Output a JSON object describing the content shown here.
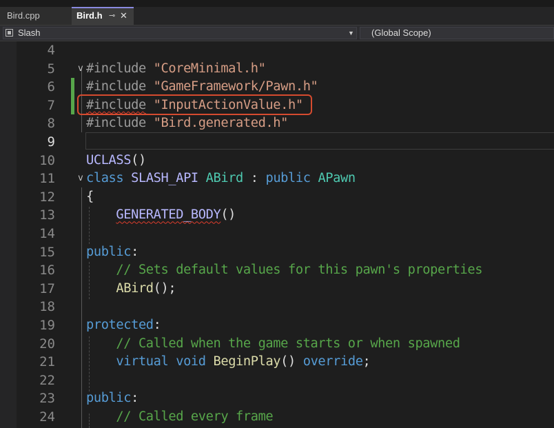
{
  "tabs": [
    {
      "label": "Bird.cpp",
      "active": false
    },
    {
      "label": "Bird.h",
      "active": true,
      "pin_icon": "pin-icon",
      "close_icon": "close-icon"
    }
  ],
  "nav": {
    "project": "Slash",
    "scope": "(Global Scope)"
  },
  "editor": {
    "current_line": 9,
    "lines": [
      {
        "n": "4"
      },
      {
        "n": "5"
      },
      {
        "n": "6"
      },
      {
        "n": "7"
      },
      {
        "n": "8"
      },
      {
        "n": "9"
      },
      {
        "n": "10"
      },
      {
        "n": "11"
      },
      {
        "n": "12"
      },
      {
        "n": "13"
      },
      {
        "n": "14"
      },
      {
        "n": "15"
      },
      {
        "n": "16"
      },
      {
        "n": "17"
      },
      {
        "n": "18"
      },
      {
        "n": "19"
      },
      {
        "n": "20"
      },
      {
        "n": "21"
      },
      {
        "n": "22"
      },
      {
        "n": "23"
      },
      {
        "n": "24"
      }
    ],
    "tokens": {
      "include": "#include",
      "inc1": "\"CoreMinimal.h\"",
      "inc2": "\"GameFramework/Pawn.h\"",
      "inc3": "\"InputActionValue.h\"",
      "inc4": "\"Bird.generated.h\"",
      "uclass": "UCLASS",
      "paren": "()",
      "class_kw": "class",
      "api": "SLASH_API",
      "abird": "ABird",
      "colon": " : ",
      "public_kw": "public",
      "apawn": "APawn",
      "lbrace": "{",
      "generated_body": "GENERATED_BODY",
      "public_label": "public",
      "protected_label": "protected",
      "colon_end": ":",
      "comment1": "// Sets default values for this pawn's properties",
      "ctor": "ABird",
      "ctor_end": "();",
      "comment2": "// Called when the game starts or when spawned",
      "virtual_kw": "virtual",
      "void_kw": "void",
      "beginplay": "BeginPlay",
      "override_kw": "override",
      "semi": ";",
      "comment3": "// Called every frame"
    },
    "fold_glyph": "v",
    "colors": {
      "keyword": "#569cd6",
      "type": "#4ec9b0",
      "string": "#d69d85",
      "comment": "#57a64a",
      "macro": "#bd63c5",
      "function": "#dcdcaa",
      "highlight_box": "#d64b2f",
      "change_bar": "#57a64a"
    }
  }
}
